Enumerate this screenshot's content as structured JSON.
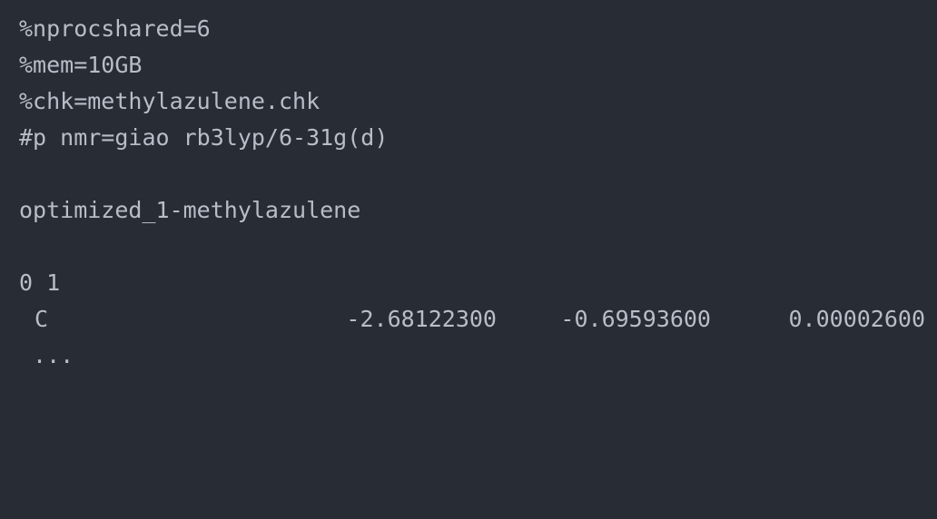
{
  "input_file": {
    "link0": [
      "%nprocshared=6",
      "%mem=10GB",
      "%chk=methylazulene.chk"
    ],
    "route": "#p nmr=giao rb3lyp/6-31g(d)",
    "title": "optimized_1-methylazulene",
    "charge_multiplicity": "0 1",
    "atoms": [
      {
        "symbol": "C",
        "x": "-2.68122300",
        "y": "-0.69593600",
        "z": "0.00002600"
      }
    ],
    "continuation": " ..."
  },
  "colors": {
    "background": "#282c34",
    "text": "#b6bec9"
  }
}
